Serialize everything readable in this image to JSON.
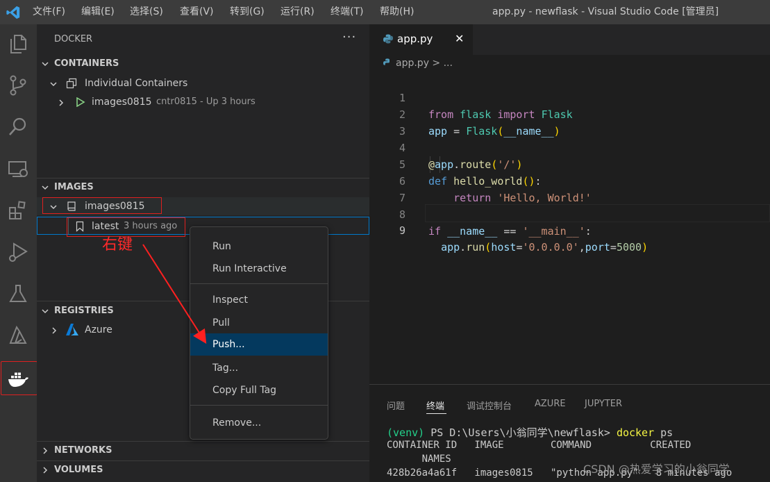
{
  "titlebar": {
    "menus": [
      "文件(F)",
      "编辑(E)",
      "选择(S)",
      "查看(V)",
      "转到(G)",
      "运行(R)",
      "终端(T)",
      "帮助(H)"
    ],
    "title": "app.py - newflask - Visual Studio Code [管理员]"
  },
  "activity_bar": {
    "icons": [
      "explorer-icon",
      "source-control-icon",
      "search-icon",
      "remote-explorer-icon",
      "extensions-icon",
      "run-debug-icon",
      "testing-icon",
      "azure-icon",
      "docker-icon"
    ],
    "active": "docker-icon"
  },
  "sidebar": {
    "title": "DOCKER",
    "more": "···",
    "containers": {
      "header": "CONTAINERS",
      "group": "Individual Containers",
      "item_name": "images0815",
      "item_detail": "cntr0815 - Up 3 hours"
    },
    "images": {
      "header": "IMAGES",
      "repo": "images0815",
      "tag": "latest",
      "tag_detail": "3 hours ago"
    },
    "registries": {
      "header": "REGISTRIES",
      "item": "Azure"
    },
    "networks": {
      "header": "NETWORKS"
    },
    "volumes": {
      "header": "VOLUMES"
    }
  },
  "context_menu": {
    "items": [
      "Run",
      "Run Interactive",
      "Inspect",
      "Pull",
      "Push...",
      "Tag...",
      "Copy Full Tag",
      "Remove..."
    ],
    "selected": "Push..."
  },
  "annotation": {
    "label": "右键",
    "color": "#ff2a2a"
  },
  "editor": {
    "tab": "app.py",
    "close": "✕",
    "breadcrumb": "app.py > ...",
    "line_numbers": [
      "1",
      "2",
      "3",
      "4",
      "5",
      "6",
      "7",
      "8",
      "9"
    ],
    "current_line": "9"
  },
  "panel": {
    "tabs": [
      "问题",
      "终端",
      "调试控制台",
      "AZURE",
      "JUPYTER"
    ],
    "active_tab": "终端",
    "terminal": {
      "prompt_env": "(venv)",
      "prompt_path": " PS D:\\Users\\小翁同学\\newflask> ",
      "command": "docker",
      "command_arg": " ps",
      "header1": "CONTAINER ID   IMAGE        COMMAND          CREATED",
      "header2": "      NAMES",
      "row1": "428b26a4a61f   images0815   \"python app.py\"   8 minutes ago"
    }
  },
  "watermark": "CSDN @热爱学习的小翁同学",
  "colors": {
    "accent": "#007acc",
    "selection": "#04395e",
    "annotation": "#e02020",
    "run_triangle": "#89d185"
  }
}
